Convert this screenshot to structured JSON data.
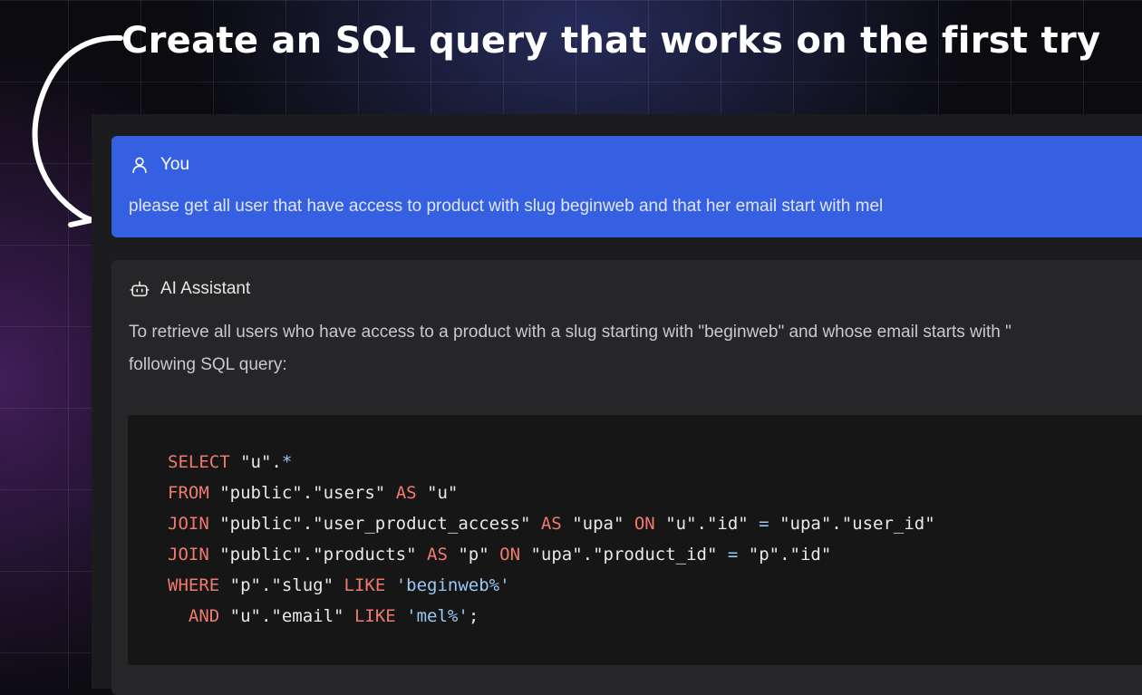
{
  "headline": "Create an SQL query that works on the first try",
  "user_message": {
    "author": "You",
    "icon": "user-icon",
    "text": "please get all user that have access to product with slug beginweb and that her email start with mel"
  },
  "ai_message": {
    "author": "AI Assistant",
    "icon": "robot-icon",
    "text_line1": "To retrieve all users who have access to a product with a slug starting with \"beginweb\" and whose email starts with \"",
    "text_line2": "following SQL query:",
    "code": {
      "l1": [
        "SELECT",
        "\"u\".",
        "*"
      ],
      "l2": [
        "FROM",
        "\"public\".\"users\"",
        "AS",
        "\"u\""
      ],
      "l3": [
        "JOIN",
        "\"public\".\"user_product_access\"",
        "AS",
        "\"upa\"",
        "ON",
        "\"u\".\"id\"",
        "=",
        "\"upa\".\"user_id\""
      ],
      "l4": [
        "JOIN",
        "\"public\".\"products\"",
        "AS",
        "\"p\"",
        "ON",
        "\"upa\".\"product_id\"",
        "=",
        "\"p\".\"id\""
      ],
      "l5": [
        "WHERE",
        "\"p\".\"slug\"",
        "LIKE",
        "'beginweb%'"
      ],
      "l6": [
        "  AND",
        "\"u\".\"email\"",
        "LIKE",
        "'mel%'",
        ";"
      ]
    }
  },
  "colors": {
    "user_card": "#3660e2",
    "ai_card": "#262628",
    "code_bg": "#161617",
    "keyword": "#f07a6e",
    "literal": "#9ac8f5"
  }
}
